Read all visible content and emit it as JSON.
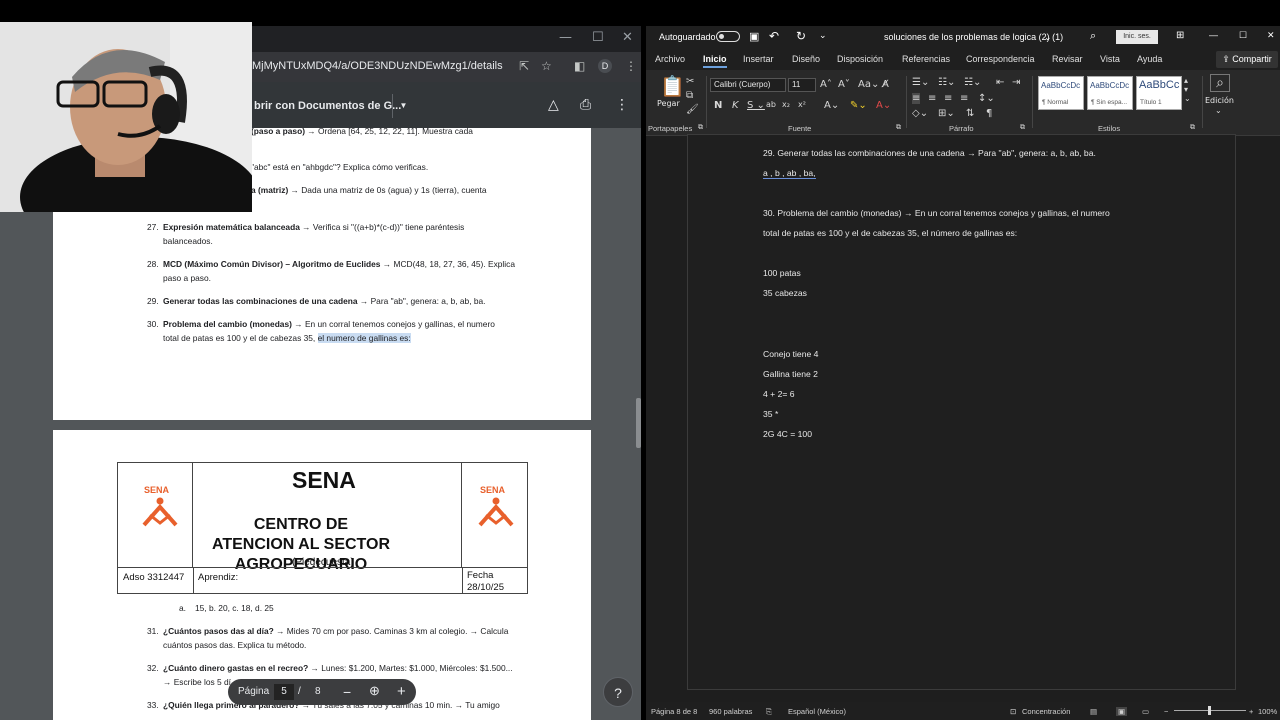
{
  "browser": {
    "url": "MjMyNTUxMDQ4/a/ODE3NDUzNDEwMzg1/details",
    "avatar_letter": "D",
    "open_with_label": "brir con Documentos de G...",
    "page_label": "Página",
    "page_current": "5",
    "page_sep": "/",
    "page_total": "8"
  },
  "pdf_page4": {
    "lines": [
      {
        "num": "",
        "bold": "(paso a paso)",
        "text": " → Ordena [64, 25, 12, 22, 11]. Muestra cada"
      },
      {
        "num": "",
        "bold": "",
        "text": "\"abc\" está en \"ahbgdc\"? Explica cómo verificas."
      },
      {
        "num": "",
        "bold": "a (matriz)",
        "text": " → Dada una matriz de 0s (agua) y 1s (tierra), cuenta"
      },
      {
        "num": "27.",
        "bold": "Expresión matemática balanceada",
        "text": " → Verifica si \"((a+b)*(c-d))\" tiene paréntesis"
      },
      {
        "num": "",
        "bold": "",
        "text": "balanceados."
      },
      {
        "num": "28.",
        "bold": "MCD (Máximo Común Divisor) – Algoritmo de Euclides",
        "text": " → MCD(48, 18, 27, 36, 45). Explica"
      },
      {
        "num": "",
        "bold": "",
        "text": "paso a paso."
      },
      {
        "num": "29.",
        "bold": "Generar todas las combinaciones de una cadena",
        "text": " → Para \"ab\", genera: a, b, ab, ba."
      },
      {
        "num": "30.",
        "bold": "Problema del cambio (monedas)",
        "text": " → En un corral tenemos conejos y gallinas, el numero"
      },
      {
        "num": "",
        "bold": "",
        "text": "total de patas es 100 y el de cabezas 35, ",
        "highlight": "el numero de gallinas es:"
      }
    ]
  },
  "pdf_page5": {
    "header_title": "SENA",
    "header_center": "CENTRO DE ATENCION AL SECTOR AGROPECUARIO",
    "header_city": "(Piedecuesta)",
    "logo_text": "SENA",
    "row_left": "Adso 3312447",
    "row_mid": "Aprendiz:",
    "row_right_1": "Fecha",
    "row_right_2": "28/10/25",
    "answer_line": {
      "num": "a.",
      "text": "15, b. 20, c. 18, d. 25"
    },
    "q31": {
      "num": "31.",
      "bold": "¿Cuántos pasos das al día?",
      "text": " → Mides 70 cm por paso. Caminas 3 km al colegio. → Calcula"
    },
    "q31b": "cuántos pasos das. Explica tu método.",
    "q32": {
      "num": "32.",
      "bold": "¿Cuánto dinero gastas en el recreo?",
      "text": " → Lunes: $1.200, Martes: $1.000, Miércoles: $1.500..."
    },
    "q32b": "→ Escribe los 5 dí... y suma... Te alcanza con $6.000?",
    "q33": {
      "num": "33.",
      "bold": "¿Quién llega primero al paradero?",
      "text": " → Tú sales a las 7:05 y caminas 10 min. → Tu amigo"
    }
  },
  "word": {
    "autosave": "Autoguardado",
    "doc_title": "soluciones de los problemas de logica (2) (1)",
    "signin": "Inic. ses.",
    "tabs": [
      "Archivo",
      "Inicio",
      "Insertar",
      "Diseño",
      "Disposición",
      "Referencias",
      "Correspondencia",
      "Revisar",
      "Vista",
      "Ayuda"
    ],
    "share": "Compartir",
    "ribbon": {
      "paste": "Pegar",
      "clipboard": "Portapapeles",
      "font_name": "Calibri (Cuerpo)",
      "font_size": "11",
      "font_group": "Fuente",
      "paragraph_group": "Párrafo",
      "styles_group": "Estilos",
      "editing": "Edición",
      "styles": [
        {
          "sample": "AaBbCcDc",
          "name": "¶ Normal"
        },
        {
          "sample": "AaBbCcDc",
          "name": "¶ Sin espa..."
        },
        {
          "sample": "AaBbCc",
          "name": "Título 1"
        }
      ]
    },
    "doc_lines": [
      "29. Generar todas las combinaciones de una cadena → Para \"ab\", genera: a, b, ab, ba.",
      "a , b , ab , ba,",
      "30. Problema del cambio (monedas) → En un corral tenemos conejos y gallinas, el numero",
      "total de patas es 100 y el de cabezas 35, el número de gallinas es:",
      "100 patas",
      "35 cabezas",
      "Conejo tiene 4",
      "Gallina tiene 2",
      "4 + 2= 6",
      "35 *",
      "2G  4C = 100"
    ],
    "status": {
      "page": "Página 8 de 8",
      "words": "960 palabras",
      "language": "Español (México)",
      "focus": "Concentración",
      "zoom": "100%"
    }
  },
  "colors": {
    "sena_orange": "#e8602c",
    "word_accent": "#6ca0dc"
  }
}
